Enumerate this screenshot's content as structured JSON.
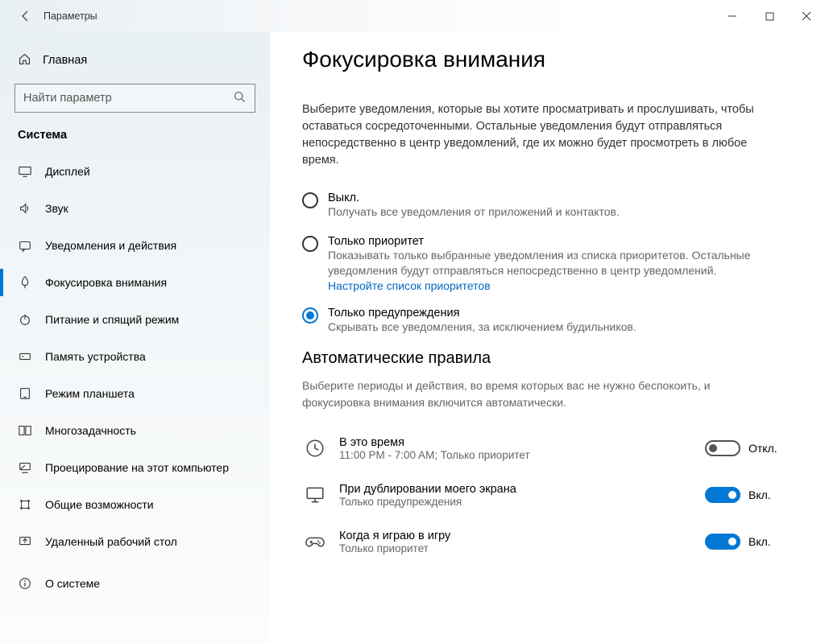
{
  "window": {
    "title": "Параметры"
  },
  "sidebar": {
    "home": "Главная",
    "search_placeholder": "Найти параметр",
    "section": "Система",
    "items": [
      {
        "label": "Дисплей"
      },
      {
        "label": "Звук"
      },
      {
        "label": "Уведомления и действия"
      },
      {
        "label": "Фокусировка внимания"
      },
      {
        "label": "Питание и спящий режим"
      },
      {
        "label": "Память устройства"
      },
      {
        "label": "Режим планшета"
      },
      {
        "label": "Многозадачность"
      },
      {
        "label": "Проецирование на этот компьютер"
      },
      {
        "label": "Общие возможности"
      },
      {
        "label": "Удаленный рабочий стол"
      },
      {
        "label": "О системе"
      }
    ]
  },
  "main": {
    "title": "Фокусировка внимания",
    "intro": "Выберите уведомления, которые вы хотите просматривать и прослушивать, чтобы оставаться сосредоточенными. Остальные уведомления будут отправляться непосредственно в центр уведомлений, где их можно будет просмотреть в любое время.",
    "radios": [
      {
        "label": "Выкл.",
        "desc": "Получать все уведомления от приложений и контактов."
      },
      {
        "label": "Только приоритет",
        "desc": "Показывать только выбранные уведомления из списка приоритетов. Остальные уведомления будут отправляться непосредственно в центр уведомлений.",
        "link": "Настройте список приоритетов"
      },
      {
        "label": "Только предупреждения",
        "desc": "Скрывать все уведомления, за исключением будильников."
      }
    ],
    "selected_radio": 2,
    "auto_title": "Автоматические правила",
    "auto_desc": "Выберите периоды и действия, во время которых вас не нужно беспокоить, и фокусировка внимания включится автоматически.",
    "rules": [
      {
        "title": "В это время",
        "sub": "11:00 PM - 7:00 AM; Только приоритет",
        "state": "off",
        "state_label": "Откл."
      },
      {
        "title": "При дублировании моего экрана",
        "sub": "Только предупреждения",
        "state": "on",
        "state_label": "Вкл."
      },
      {
        "title": "Когда я играю в игру",
        "sub": "Только приоритет",
        "state": "on",
        "state_label": "Вкл."
      }
    ]
  }
}
